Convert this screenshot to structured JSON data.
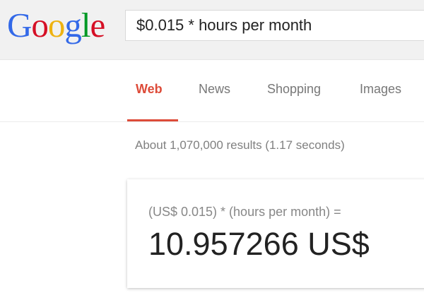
{
  "logo": {
    "letters": [
      "G",
      "o",
      "o",
      "g",
      "l",
      "e"
    ],
    "colors": [
      "#3369e8",
      "#d50f25",
      "#eeb211",
      "#3369e8",
      "#009925",
      "#d50f25"
    ]
  },
  "search": {
    "value": "$0.015 * hours per month"
  },
  "tabs": [
    {
      "label": "Web",
      "active": true
    },
    {
      "label": "News",
      "active": false
    },
    {
      "label": "Shopping",
      "active": false
    },
    {
      "label": "Images",
      "active": false
    }
  ],
  "results": {
    "stats": "About 1,070,000 results (1.17 seconds)"
  },
  "calculator": {
    "expression": "(US$ 0.015) * (hours per month) =",
    "result": "10.957266 US$"
  },
  "colors": {
    "accent": "#dd4b39",
    "header_bg": "#f1f1f1"
  }
}
